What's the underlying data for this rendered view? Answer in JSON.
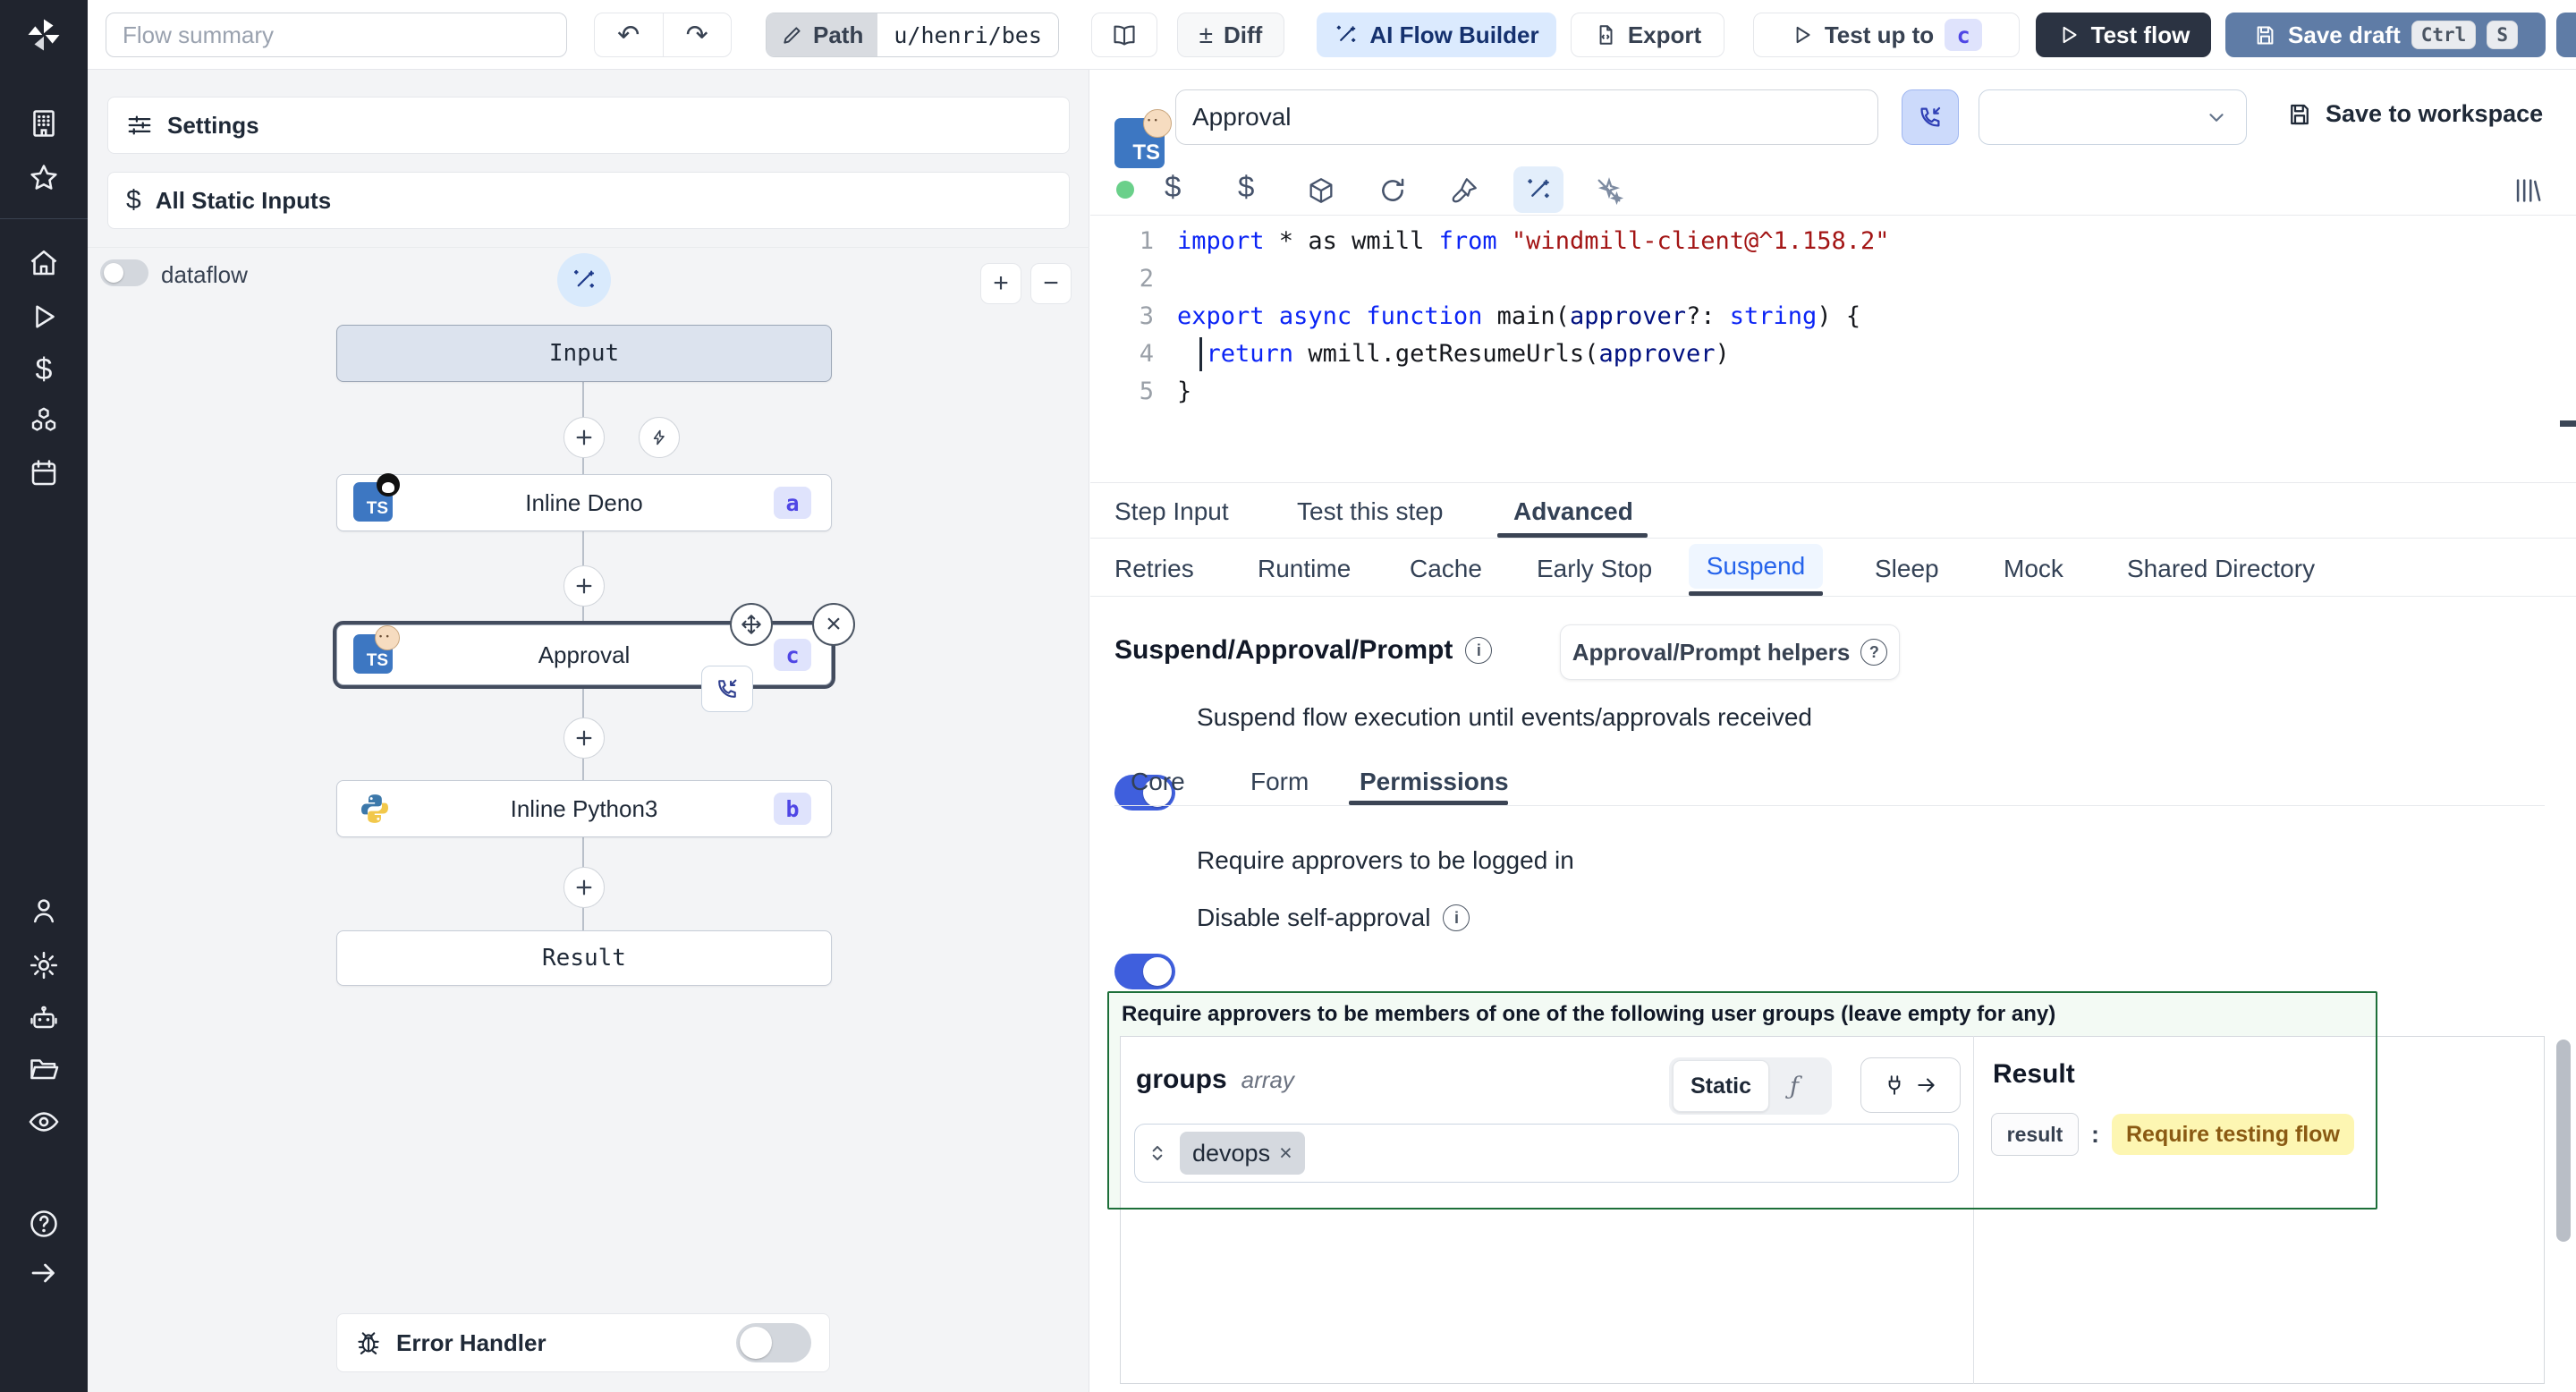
{
  "topbar": {
    "flow_summary_placeholder": "Flow summary",
    "undo_glyph": "↶",
    "redo_glyph": "↷",
    "path_label": "Path",
    "path_value": "u/henri/bes",
    "diff_sign": "±",
    "diff_label": "Diff",
    "ai_flow_builder_label": "AI Flow Builder",
    "export_label": "Export",
    "test_up_to_label": "Test up to",
    "test_up_to_badge": "c",
    "test_flow_label": "Test flow",
    "save_draft_label": "Save draft",
    "save_draft_keys": [
      "Ctrl",
      "S"
    ]
  },
  "sidebar": {
    "icons": [
      "windmill-logo",
      "workspace-building",
      "favorites-star",
      "home",
      "runs-play",
      "variables-dollar",
      "resources-cubes",
      "schedules-calendar",
      "user-person",
      "settings-gear",
      "workers-robot",
      "folders-folder",
      "audit-eye",
      "help-circle",
      "expand-arrow-right"
    ]
  },
  "flow_panel": {
    "settings_label": "Settings",
    "all_static_inputs_label": "All Static Inputs",
    "dataflow_label": "dataflow",
    "zoom_in_glyph": "+",
    "zoom_out_glyph": "−",
    "close_glyph": "×",
    "nodes": {
      "input_label": "Input",
      "deno_label": "Inline Deno",
      "deno_badge": "a",
      "approval_label": "Approval",
      "approval_badge": "c",
      "python_label": "Inline Python3",
      "python_badge": "b",
      "result_label": "Result"
    },
    "error_handler_label": "Error Handler"
  },
  "step_editor": {
    "step_name": "Approval",
    "save_to_workspace_label": "Save to workspace",
    "code": {
      "lines": [
        [
          {
            "c": "kw",
            "t": "import"
          },
          {
            "c": "pl",
            "t": " * as wmill "
          },
          {
            "c": "kw",
            "t": "from"
          },
          {
            "c": "pl",
            "t": " "
          },
          {
            "c": "str",
            "t": "\"windmill-client@^1.158.2\""
          }
        ],
        [],
        [
          {
            "c": "kw",
            "t": "export"
          },
          {
            "c": "pl",
            "t": " "
          },
          {
            "c": "kw",
            "t": "async"
          },
          {
            "c": "pl",
            "t": " "
          },
          {
            "c": "kw",
            "t": "function"
          },
          {
            "c": "pl",
            "t": " main("
          },
          {
            "c": "var",
            "t": "approver"
          },
          {
            "c": "pl",
            "t": "?: "
          },
          {
            "c": "kw",
            "t": "string"
          },
          {
            "c": "pl",
            "t": ") {"
          }
        ],
        [
          {
            "c": "pl",
            "t": "  "
          },
          {
            "c": "kw",
            "t": "return"
          },
          {
            "c": "pl",
            "t": " wmill.getResumeUrls("
          },
          {
            "c": "var",
            "t": "approver"
          },
          {
            "c": "pl",
            "t": ")"
          }
        ],
        [
          {
            "c": "pl",
            "t": "}"
          }
        ]
      ]
    },
    "tabs": [
      "Step Input",
      "Test this step",
      "Advanced"
    ],
    "active_tab": "Advanced",
    "subtabs": [
      "Retries",
      "Runtime",
      "Cache",
      "Early Stop",
      "Suspend",
      "Sleep",
      "Mock",
      "Shared Directory"
    ],
    "active_subtab": "Suspend",
    "suspend": {
      "heading": "Suspend/Approval/Prompt",
      "helpers_button_label": "Approval/Prompt helpers",
      "suspend_toggle_label": "Suspend flow execution until events/approvals received",
      "inner_tabs": [
        "Core",
        "Form",
        "Permissions"
      ],
      "active_inner_tab": "Permissions",
      "require_logged_in_label": "Require approvers to be logged in",
      "disable_self_approval_label": "Disable self-approval",
      "groups_title": "Require approvers to be members of one of the following user groups (leave empty for any)",
      "groups_field": "groups",
      "groups_type": "array",
      "static_label": "Static",
      "fx_label": "ƒ",
      "chip_label": "devops",
      "chip_remove_glyph": "×",
      "result_title": "Result",
      "result_key": "result",
      "result_colon": ":",
      "result_value": "Require testing flow"
    }
  },
  "colors": {
    "toggle_on": "#3f5fdd",
    "badge_bg": "#dfe3fc",
    "badge_text": "#4f46e5",
    "green_border": "#1d6f39",
    "yellow_bg": "#fdf6b2",
    "yellow_text": "#8a5a13",
    "save_draft_bg": "#5f7ca6",
    "test_flow_bg": "#2b3342",
    "ai_button_bg": "#dbeafe",
    "suspend_tab_text": "#2563eb"
  }
}
